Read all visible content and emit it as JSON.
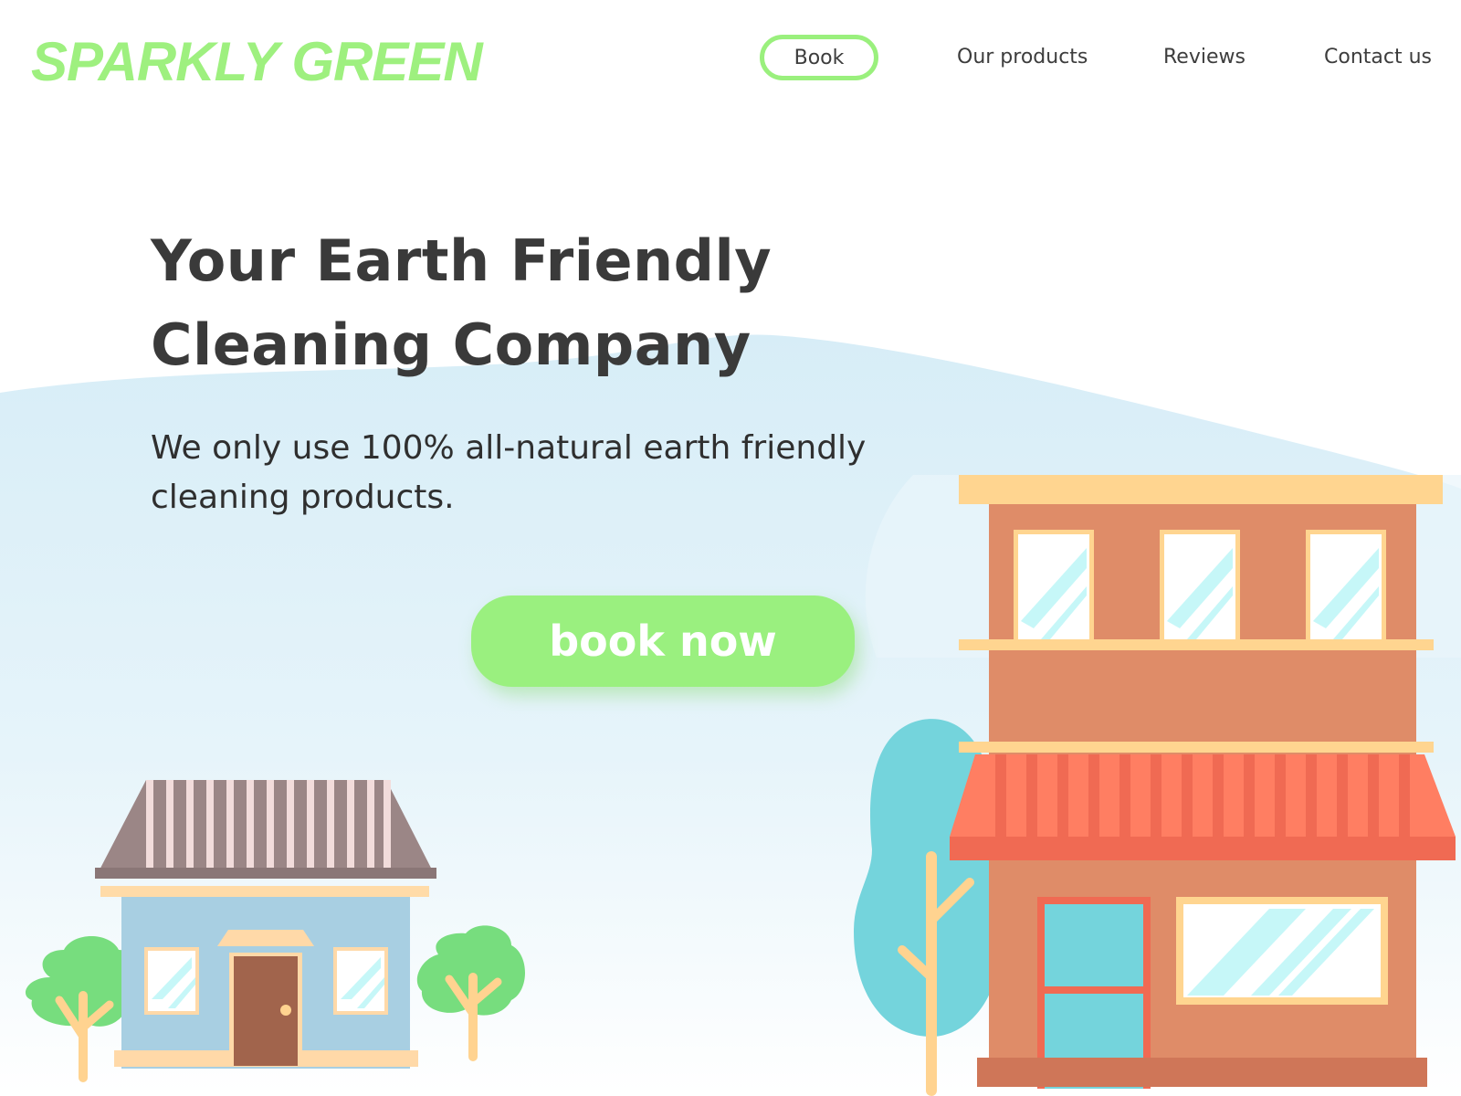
{
  "header": {
    "logo_text": "SPARKLY GREEN",
    "nav": {
      "book_label": "Book",
      "products_label": "Our products",
      "reviews_label": "Reviews",
      "contact_label": "Contact us"
    }
  },
  "hero": {
    "title": "Your Earth Friendly Cleaning Company",
    "subtitle": "We only use 100% all-natural earth friendly cleaning products.",
    "cta_label": "book now"
  },
  "colors": {
    "accent_green": "#9af07f",
    "text_dark": "#3a3a3a",
    "sky_blue": "#d9eef8",
    "building_brown": "#df8c68",
    "awning_red": "#f0705a",
    "tree_teal": "#74d4dc"
  },
  "icons": {
    "illustration": "houses-and-trees-illustration"
  }
}
